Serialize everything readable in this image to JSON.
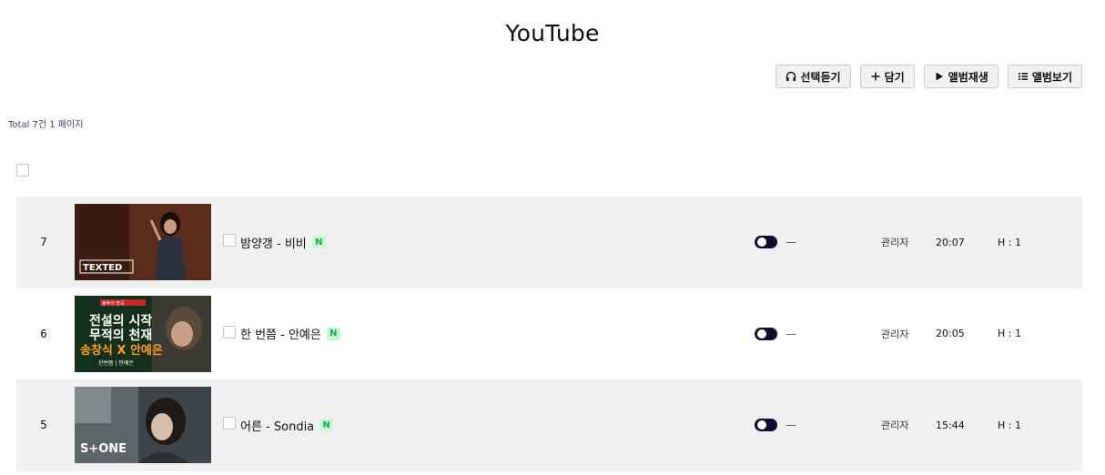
{
  "page": {
    "title": "YouTube"
  },
  "toolbar": {
    "buttons": [
      {
        "label": "선택듣기",
        "icon": "headphones-icon"
      },
      {
        "label": "담기",
        "icon": "plus-icon"
      },
      {
        "label": "앨범재생",
        "icon": "play-icon"
      },
      {
        "label": "앨범보기",
        "icon": "list-icon"
      }
    ]
  },
  "summary": {
    "total": "Total 7건 1 페이지"
  },
  "rows": [
    {
      "num": "7",
      "title": "밤양갱 - 비비",
      "badge": "N",
      "status": "—",
      "author": "관리자",
      "time": "20:07",
      "hits": "H : 1",
      "thumb": {
        "caption": "TEXTED"
      }
    },
    {
      "num": "6",
      "title": "한 번쯤 - 안예은",
      "badge": "N",
      "status": "—",
      "author": "관리자",
      "time": "20:05",
      "hits": "H : 1",
      "thumb": {
        "line1": "전설의 시작",
        "line2": "무적의 천재",
        "line3": "송창식 X 안예은",
        "small": "한번쯤 | 안예은",
        "tag": "불후의 명곡"
      }
    },
    {
      "num": "5",
      "title": "어른 - Sondia",
      "badge": "N",
      "status": "—",
      "author": "관리자",
      "time": "15:44",
      "hits": "H : 1",
      "thumb": {
        "caption": "S+ONE"
      }
    }
  ],
  "colors": {
    "badge_bg": "#c6f7d6",
    "badge_text": "#14b14a",
    "toggle": "#0d0a2e",
    "row_shade": "#f0f0f0"
  }
}
